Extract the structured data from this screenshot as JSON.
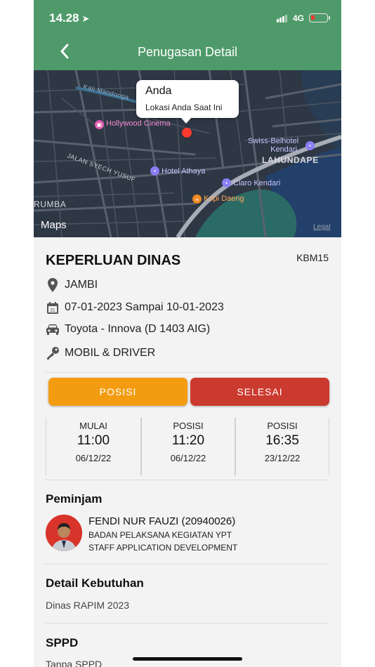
{
  "status_bar": {
    "time": "14.28",
    "network": "4G"
  },
  "nav": {
    "title": "Penugasan Detail"
  },
  "map": {
    "callout_title": "Anda",
    "callout_subtitle": "Lokasi Anda Saat Ini",
    "labels": {
      "river": "Kali Mandonga",
      "hollywood": "Hollywood Cinema",
      "street": "JALAN SYECH YUSUF",
      "athaya": "Hotel Athaya",
      "swiss1": "Swiss-Belhotel",
      "swiss2": "Kendari",
      "district": "LAHUNDAPE",
      "claro": "Claro Kendari",
      "kopi": "Kopi Daeng",
      "rumba": "RUMBA"
    },
    "logo": "Maps",
    "legal": "Legal"
  },
  "detail": {
    "title": "KEPERLUAN DINAS",
    "code": "KBM15",
    "location": "JAMBI",
    "date_range": "07-01-2023 Sampai 10-01-2023",
    "vehicle": "Toyota - Innova (D 1403 AIG)",
    "type": "MOBIL & DRIVER"
  },
  "actions": {
    "posisi_label": "POSISI",
    "selesai_label": "SELESAI"
  },
  "stats": [
    {
      "label": "MULAI",
      "time": "11:00",
      "date": "06/12/22"
    },
    {
      "label": "POSISI",
      "time": "11:20",
      "date": "06/12/22"
    },
    {
      "label": "POSISI",
      "time": "16:35",
      "date": "23/12/22"
    }
  ],
  "peminjam": {
    "heading": "Peminjam",
    "name": "FENDI NUR FAUZI (20940026)",
    "org": "BADAN PELAKSANA KEGIATAN YPT",
    "role": "STAFF APPLICATION DEVELOPMENT"
  },
  "kebutuhan": {
    "heading": "Detail Kebutuhan",
    "text": "Dinas RAPIM 2023"
  },
  "sppd": {
    "heading": "SPPD",
    "text": "Tanpa SPPD"
  },
  "colors": {
    "header": "#4f9a6a",
    "posisi": "#f39c12",
    "selesai": "#cb3a2e"
  }
}
